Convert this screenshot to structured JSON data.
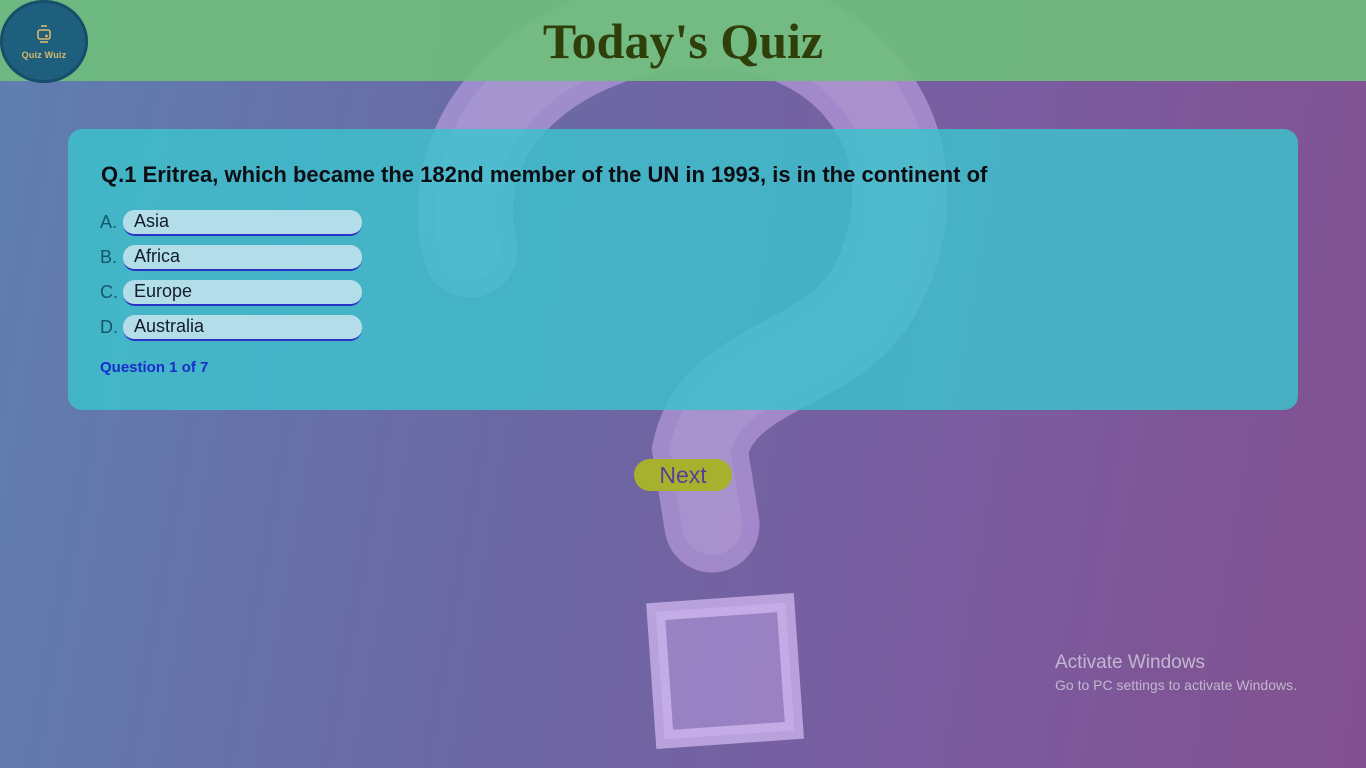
{
  "header": {
    "logo_text": "Quiz Wuiz",
    "title": "Today's Quiz"
  },
  "quiz": {
    "question": "Q.1 Eritrea, which became the 182nd member of the UN in 1993, is in the continent of",
    "options": [
      {
        "letter": "A.",
        "label": "Asia"
      },
      {
        "letter": "B.",
        "label": "Africa"
      },
      {
        "letter": "C.",
        "label": "Europe"
      },
      {
        "letter": "D.",
        "label": "Australia"
      }
    ],
    "progress": "Question 1 of 7"
  },
  "next_label": "Next",
  "watermark": {
    "title": "Activate Windows",
    "subtitle": "Go to PC settings to activate Windows."
  },
  "colors": {
    "header": "#70be7d",
    "card": "#3cc3cd",
    "option_bg": "#b3dde9",
    "next_bg": "#a6b22e",
    "progress_text": "#1a2ccc"
  }
}
